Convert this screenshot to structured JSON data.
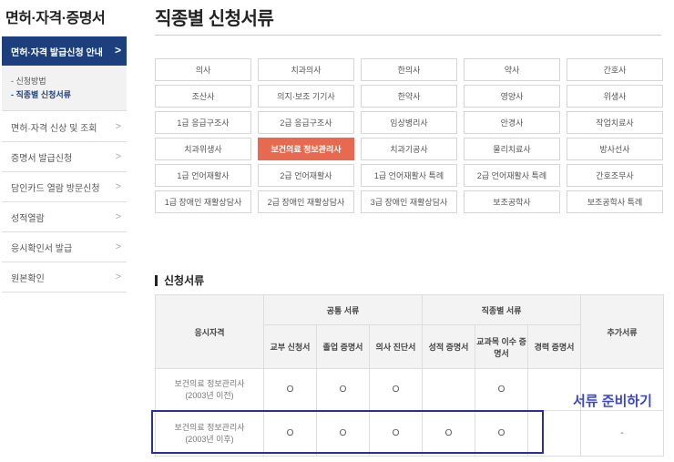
{
  "sidebar": {
    "title": "면허·자격·증명서",
    "active": {
      "label": "면허·자격 발급신청 안내",
      "chevron": ">"
    },
    "subitems": [
      {
        "label": "- 신청방법",
        "active": false
      },
      {
        "label": "- 직종별 신청서류",
        "active": true
      }
    ],
    "items": [
      {
        "label": "면허·자격 신상 및 조회",
        "chevron": ">"
      },
      {
        "label": "증명서 발급신청",
        "chevron": ">"
      },
      {
        "label": "담인카드 열람 방문신청",
        "chevron": ">"
      },
      {
        "label": "성적열람",
        "chevron": ">"
      },
      {
        "label": "응시확인서 발급",
        "chevron": ">"
      },
      {
        "label": "원본확인",
        "chevron": ">"
      }
    ]
  },
  "main": {
    "title": "직종별 신청서류",
    "jobs": [
      [
        "의사",
        "치과의사",
        "한의사",
        "약사",
        "간호사"
      ],
      [
        "조산사",
        "의지·보조 기기사",
        "한약사",
        "영양사",
        "위생사"
      ],
      [
        "1급 응급구조사",
        "2급 응급구조사",
        "임상병리사",
        "안경사",
        "작업치료사"
      ],
      [
        "치과위생사",
        "보건의료 정보관리사",
        "치과기공사",
        "물리치료사",
        "방사선사"
      ],
      [
        "1급 언어재활사",
        "2급 언어재활사",
        "1급 언어재활사 특례",
        "2급 언어재활사 특례",
        "간호조무사"
      ],
      [
        "1급 장애인 재활상담사",
        "2급 장애인 재활상담사",
        "3급 장애인 재활상담사",
        "보조공학사",
        "보조공학사 특례"
      ]
    ],
    "active_job": "보건의료 정보관리사",
    "section_title": "신청서류",
    "table": {
      "col_qual": "응시자격",
      "group_common": "공통 서류",
      "group_job": "직종별 서류",
      "col_extra": "추가서류",
      "subcols": [
        "교부 신청서",
        "졸업 증명서",
        "의사 진단서",
        "성적 증명서",
        "교과목 이수 증명서",
        "경력 증명서"
      ],
      "rows": [
        {
          "name1": "보건의료 정보관리사",
          "name2": "(2003년 이전)",
          "marks": [
            "O",
            "O",
            "O",
            "",
            "O",
            ""
          ],
          "extra": ""
        },
        {
          "name1": "보건의료 정보관리사",
          "name2": "(2003년 이후)",
          "marks": [
            "O",
            "O",
            "O",
            "O",
            "O",
            ""
          ],
          "extra": "-"
        }
      ]
    },
    "annotation": "서류 준비하기"
  },
  "colors": {
    "accent": "#1c3f7d",
    "active_job": "#e7694f",
    "annotation": "#3b47c8"
  }
}
